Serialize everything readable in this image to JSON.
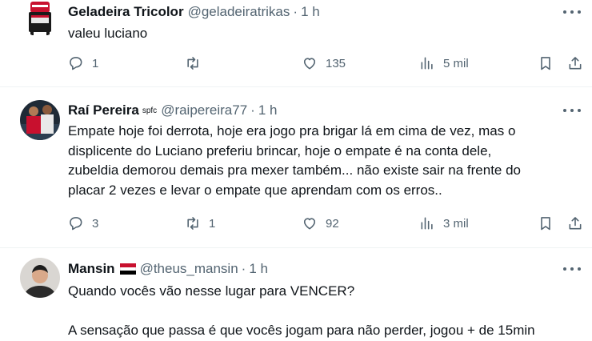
{
  "tweets": [
    {
      "name": "Geladeira Tricolor",
      "handle": "@geladeiratrikas",
      "time": "1 h",
      "text": [
        "valeu luciano"
      ],
      "replies": "1",
      "retweets": "",
      "likes": "135",
      "views": "5 mil"
    },
    {
      "name": "Raí Pereira",
      "name_suffix": "spfc",
      "handle": "@raipereira77",
      "time": "1 h",
      "text": [
        "Empate hoje foi derrota, hoje era jogo pra brigar lá em cima de vez, mas o",
        "displicente do Luciano preferiu brincar, hoje o empate é na conta dele,",
        "zubeldia demorou demais pra mexer também... não existe sair na frente do",
        "placar 2 vezes e levar o empate que aprendam com os erros.."
      ],
      "replies": "3",
      "retweets": "1",
      "likes": "92",
      "views": "3 mil"
    },
    {
      "name": "Mansin",
      "handle": "@theus_mansin",
      "time": "1 h",
      "text": [
        "Quando vocês vão nesse lugar para VENCER?",
        "",
        "A sensação que passa é que vocês jogam para não perder, jogou + de 15min"
      ]
    }
  ],
  "colors": {
    "text": "#0f1419",
    "muted": "#536471",
    "divider": "#eff3f4"
  },
  "icons": [
    "reply-icon",
    "retweet-icon",
    "like-icon",
    "views-icon",
    "bookmark-icon",
    "share-icon",
    "more-icon"
  ]
}
